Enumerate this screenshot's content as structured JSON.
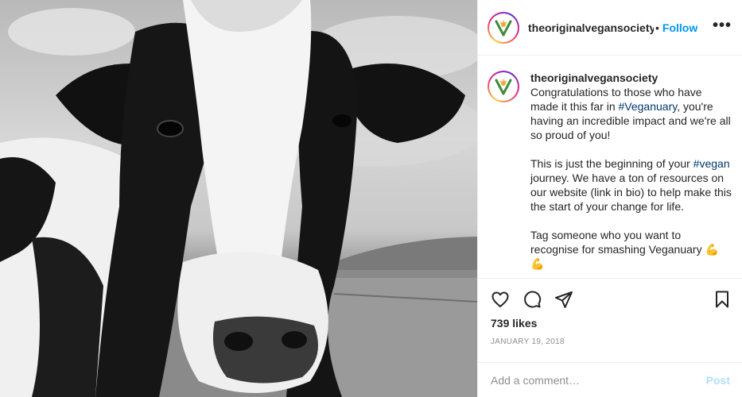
{
  "post": {
    "username": "theoriginalvegansociety",
    "header_separator": "•",
    "follow_label": "Follow",
    "more_label": "•••",
    "caption": {
      "username": "theoriginalvegansociety",
      "para1_pre": "Congratulations to those who have made it this far in ",
      "para1_tag": "#Veganuary",
      "para1_post": ", you're having an incredible impact and we're all so proud of you!",
      "para2_pre": "This is just the beginning of your ",
      "para2_tag": "#vegan",
      "para2_post": " journey. We have a ton of resources on our website (link in bio) to help make this the start of your change for life.",
      "para3": "Tag someone who you want to recognise for smashing Veganuary 💪💪"
    },
    "likes": "739 likes",
    "date": "JANUARY 19, 2018",
    "comment_placeholder": "Add a comment…",
    "post_label": "Post"
  },
  "icons": {
    "like": "heart-icon",
    "comment": "comment-bubble-icon",
    "share": "paper-plane-icon",
    "save": "bookmark-icon",
    "more": "more-dots-icon",
    "logo": "vegan-society-sunflower-logo"
  },
  "colors": {
    "follow_blue": "#0095f6",
    "hashtag": "#00376b",
    "post_disabled": "#b2dffc",
    "muted": "#8e8e8e",
    "logo_green": "#3b8b3a",
    "logo_orange": "#f2a93b"
  }
}
